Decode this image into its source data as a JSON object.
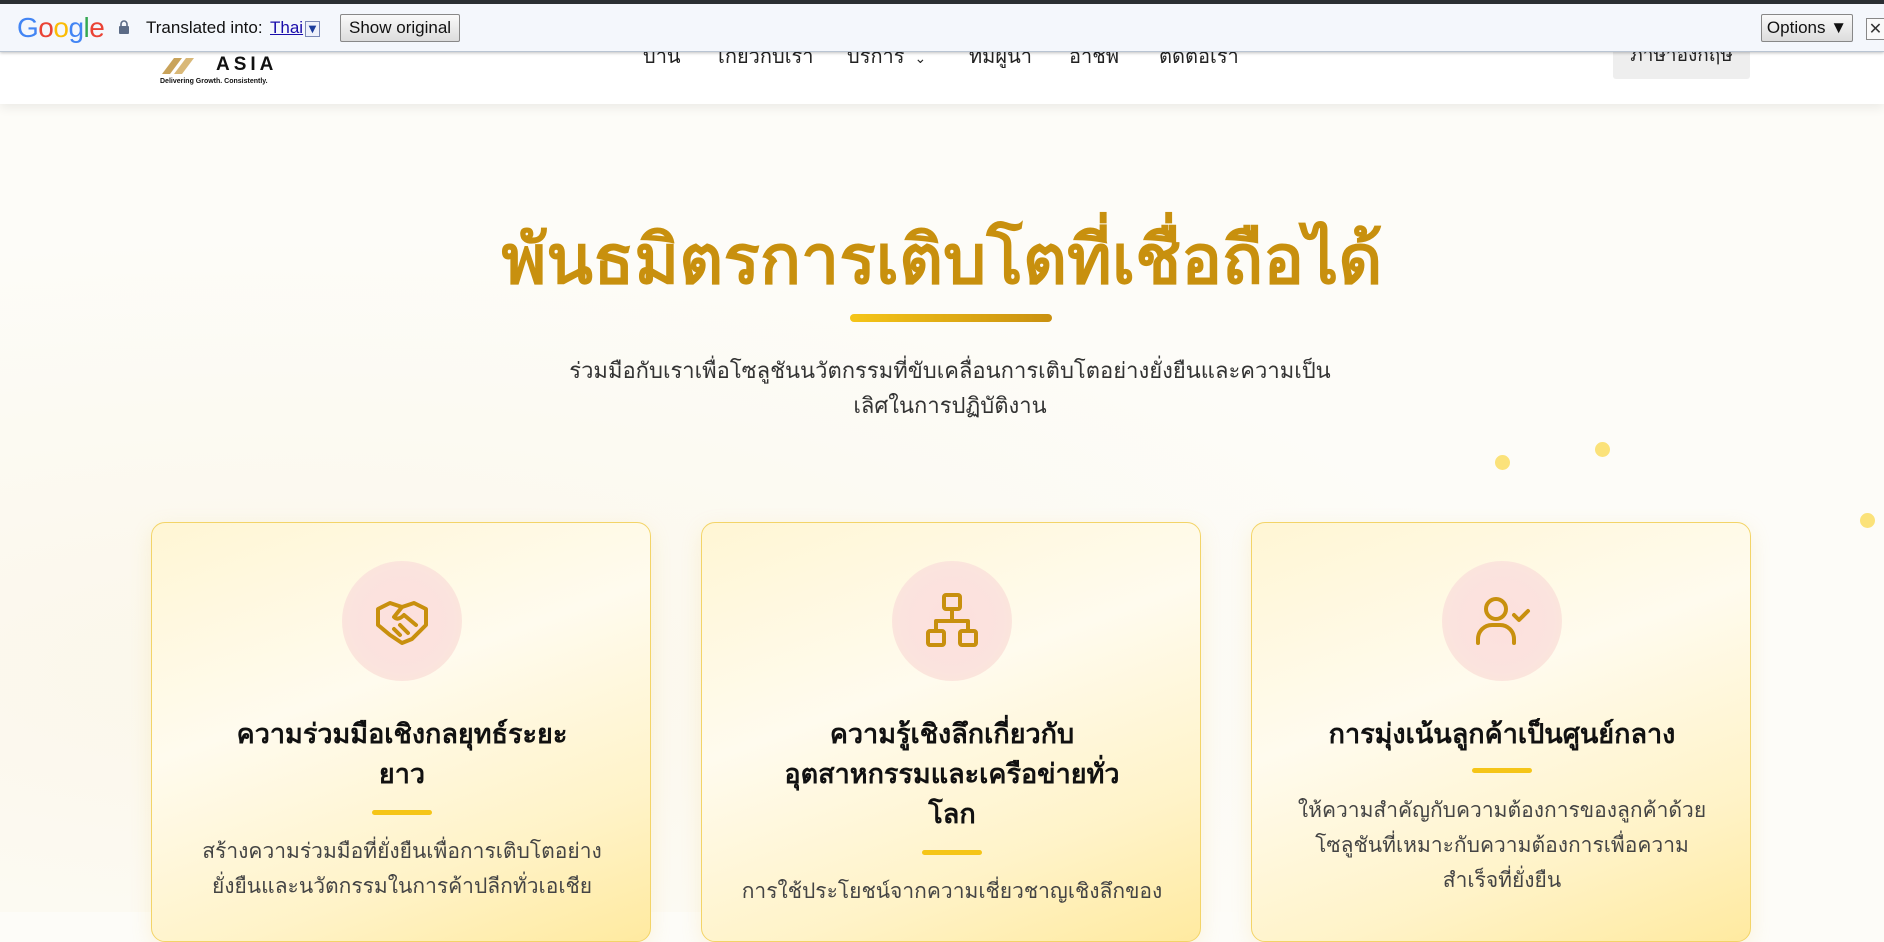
{
  "translate_bar": {
    "logo": "Google",
    "translated_into_label": "Translated into:",
    "language": "Thai",
    "dropdown_glyph": "▼",
    "show_original_label": "Show original",
    "options_label": "Options ▼",
    "close_glyph": "✕"
  },
  "header": {
    "logo_word": "ASIA",
    "logo_tagline": "Delivering Growth. Consistently.",
    "nav": [
      {
        "label": "บ้าน"
      },
      {
        "label": "เกี่ยวกับเรา"
      },
      {
        "label": "บริการ",
        "chevron": "⌄"
      },
      {
        "label": "ทีมผู้นำ"
      },
      {
        "label": "อาชีพ"
      },
      {
        "label": "ติดต่อเรา"
      }
    ],
    "language_button": "ภาษาอังกฤษ"
  },
  "hero": {
    "title": "พันธมิตรการเติบโตที่เชื่อถือได้",
    "subtitle_line1": "ร่วมมือกับเราเพื่อโซลูชันนวัตกรรมที่ขับเคลื่อนการเติบโตอย่างยั่งยืนและความเป็น",
    "subtitle_line2": "เลิศในการปฏิบัติงาน"
  },
  "cards": [
    {
      "icon": "handshake-icon",
      "title_lines": [
        "ความร่วมมือเชิงกลยุทธ์ระยะ",
        "ยาว"
      ],
      "desc_lines": [
        "สร้างความร่วมมือที่ยั่งยืนเพื่อการเติบโตอย่าง",
        "ยั่งยืนและนวัตกรรมในการค้าปลีกทั่วเอเชีย"
      ]
    },
    {
      "icon": "network-icon",
      "title_lines": [
        "ความรู้เชิงลึกเกี่ยวกับ",
        "อุตสาหกรรมและเครือข่ายทั่ว",
        "โลก"
      ],
      "desc_lines": [
        "การใช้ประโยชน์จากความเชี่ยวชาญเชิงลึกของ"
      ]
    },
    {
      "icon": "user-check-icon",
      "title_lines": [
        "การมุ่งเน้นลูกค้าเป็นศูนย์กลาง"
      ],
      "desc_lines": [
        "ให้ความสำคัญกับความต้องการของลูกค้าด้วย",
        "โซลูชันที่เหมาะกับความต้องการเพื่อความ",
        "สำเร็จที่ยั่งยืน"
      ]
    }
  ],
  "colors": {
    "accent_gold": "#c8900e",
    "accent_yellow": "#f5c518",
    "card_border": "#f3d468"
  }
}
